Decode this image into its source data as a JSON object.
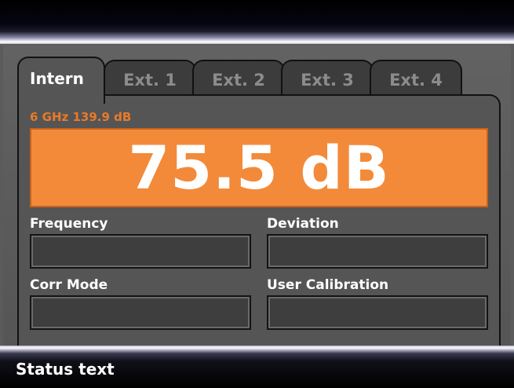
{
  "tabs": [
    {
      "label": "Intern",
      "active": true
    },
    {
      "label": "Ext. 1",
      "active": false
    },
    {
      "label": "Ext. 2",
      "active": false
    },
    {
      "label": "Ext. 3",
      "active": false
    },
    {
      "label": "Ext. 4",
      "active": false
    }
  ],
  "reference_text": "6 GHz 139.9 dB",
  "main_value": "75.5 dB",
  "fields": {
    "frequency": {
      "label": "Frequency",
      "value": ""
    },
    "deviation": {
      "label": "Deviation",
      "value": ""
    },
    "corr_mode": {
      "label": "Corr Mode",
      "value": ""
    },
    "user_calibration": {
      "label": "User Calibration",
      "value": ""
    }
  },
  "status": "Status text",
  "colors": {
    "accent": "#f28a3a",
    "accent_text": "#e87a2a",
    "background": "#555555"
  }
}
